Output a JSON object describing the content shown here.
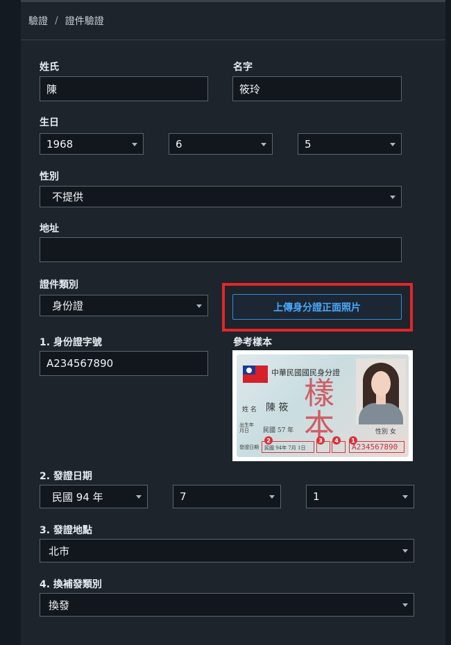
{
  "breadcrumb": {
    "root": "驗證",
    "separator": "/",
    "current": "證件驗證"
  },
  "form": {
    "surname": {
      "label": "姓氏",
      "value": "陳"
    },
    "given_name": {
      "label": "名字",
      "value": "筱玲"
    },
    "birthday": {
      "label": "生日",
      "year": "1968",
      "month": "6",
      "day": "5"
    },
    "gender": {
      "label": "性別",
      "value": "不提供"
    },
    "address": {
      "label": "地址",
      "value": ""
    },
    "doc_type": {
      "label": "證件類別",
      "value": "身份證"
    },
    "upload_button": "上傳身分證正面照片",
    "reference": {
      "label": "參考樣本",
      "card_title": "中華民國國民身分證",
      "stamp": "樣本",
      "name_label": "姓 名",
      "name_value": "陳 筱",
      "birth_label": "出生年月日",
      "birth_value": "民國 57 年",
      "gender_label": "性別 女",
      "issue_label": "發證日期",
      "issue_value": "民國 94年 7月 1日",
      "markers": [
        "1",
        "2",
        "3",
        "4"
      ],
      "id_number": "A234567890"
    },
    "id_number": {
      "label": "1. 身份證字號",
      "value": "A234567890"
    },
    "issue_date": {
      "label": "2. 發證日期",
      "year": "民國 94 年",
      "month": "7",
      "day": "1"
    },
    "issue_place": {
      "label": "3. 發證地點",
      "value": "北市"
    },
    "reissue_type": {
      "label": "4. 換補發類別",
      "value": "換發"
    }
  },
  "colors": {
    "background": "#1d242c",
    "field_bg": "#12171d",
    "accent": "#2f8fe0",
    "highlight": "#e3262a"
  }
}
